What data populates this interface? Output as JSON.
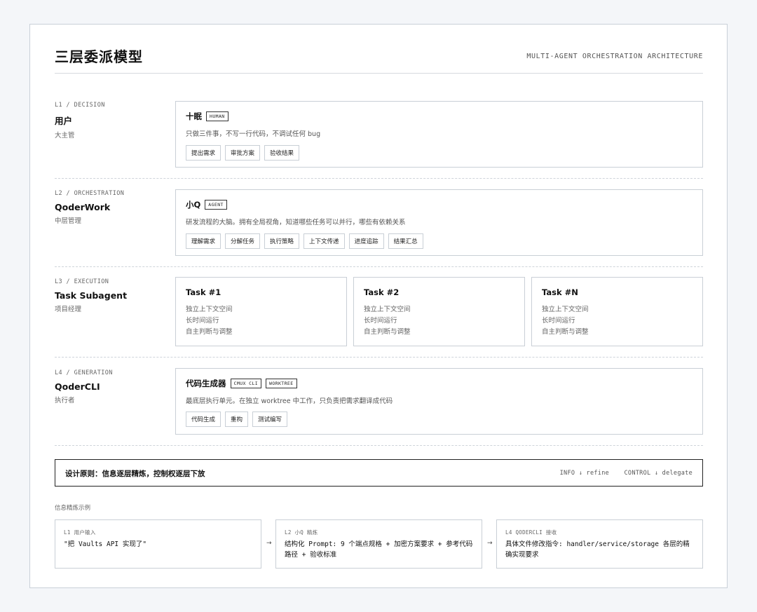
{
  "header": {
    "title": "三层委派模型",
    "subtitle": "MULTI-AGENT ORCHESTRATION ARCHITECTURE"
  },
  "layers": [
    {
      "id": "L1 / DECISION",
      "name": "用户",
      "role": "大主管",
      "box": {
        "title": "十眠",
        "badges": [
          "HUMAN"
        ],
        "desc": "只做三件事，不写一行代码，不调试任何 bug",
        "chips": [
          "提出需求",
          "审批方案",
          "验收结果"
        ]
      }
    },
    {
      "id": "L2 / ORCHESTRATION",
      "name": "QoderWork",
      "role": "中层管理",
      "box": {
        "title": "小Q",
        "badges": [
          "AGENT"
        ],
        "desc": "研发流程的大脑。拥有全局视角，知道哪些任务可以并行，哪些有依赖关系",
        "chips": [
          "理解需求",
          "分解任务",
          "执行策略",
          "上下文传递",
          "进度追踪",
          "结果汇总"
        ]
      }
    },
    {
      "id": "L3 / EXECUTION",
      "name": "Task Subagent",
      "role": "项目经理",
      "tasks": [
        {
          "title": "Task #1",
          "lines": [
            "独立上下文空间",
            "长时间运行",
            "自主判断与调整"
          ]
        },
        {
          "title": "Task #2",
          "lines": [
            "独立上下文空间",
            "长时间运行",
            "自主判断与调整"
          ]
        },
        {
          "title": "Task #N",
          "lines": [
            "独立上下文空间",
            "长时间运行",
            "自主判断与调整"
          ]
        }
      ]
    },
    {
      "id": "L4 / GENERATION",
      "name": "QoderCLI",
      "role": "执行者",
      "box": {
        "title": "代码生成器",
        "badges": [
          "CMUX CLI",
          "WORKTREE"
        ],
        "desc": "最底层执行单元。在独立 worktree 中工作，只负责把需求翻译成代码",
        "chips": [
          "代码生成",
          "重构",
          "测试编写"
        ]
      }
    }
  ],
  "principle": {
    "text": "设计原则：信息逐层精炼，控制权逐层下放",
    "info": "INFO ↓ refine",
    "control": "CONTROL ↓ delegate"
  },
  "examples": {
    "label": "信息精炼示例",
    "arrow": "→",
    "items": [
      {
        "head": "L1 用户输入",
        "body": "\"把 Vaults API 实现了\""
      },
      {
        "head": "L2 小Q 精炼",
        "body": "结构化 Prompt: 9 个端点规格 + 加密方案要求 + 参考代码路径 + 验收标准"
      },
      {
        "head": "L4 QODERCLI 接收",
        "body": "具体文件修改指令: handler/service/storage 各层的精确实现要求"
      }
    ]
  }
}
